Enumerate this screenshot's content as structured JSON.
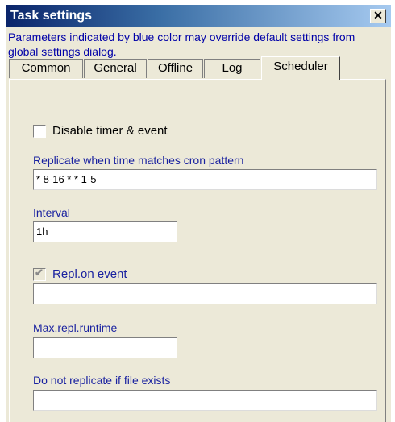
{
  "window": {
    "title": "Task settings",
    "close_glyph": "✕",
    "colors": {
      "title_bar": "#0a246a",
      "face": "#ece9d8",
      "override_text": "#0000a8"
    }
  },
  "info_text": "Parameters indicated by blue color may override default settings from global settings dialog.",
  "tabs": [
    {
      "label": "Common",
      "active": false
    },
    {
      "label": "General",
      "active": false
    },
    {
      "label": "Offline",
      "active": false
    },
    {
      "label": "Log",
      "active": false
    },
    {
      "label": "Scheduler",
      "active": true
    }
  ],
  "scheduler": {
    "disable_timer": {
      "label": "Disable timer & event",
      "checked": false
    },
    "cron": {
      "label": "Replicate when time matches cron pattern",
      "value": "* 8-16 * * 1-5"
    },
    "interval": {
      "label": "Interval",
      "value": "1h"
    },
    "repl_on_event": {
      "label": "Repl.on event",
      "checked": true,
      "enabled": false,
      "value": ""
    },
    "max_runtime": {
      "label": "Max.repl.runtime",
      "value": ""
    },
    "not_if_file": {
      "label": "Do not replicate if file exists",
      "value": ""
    }
  }
}
